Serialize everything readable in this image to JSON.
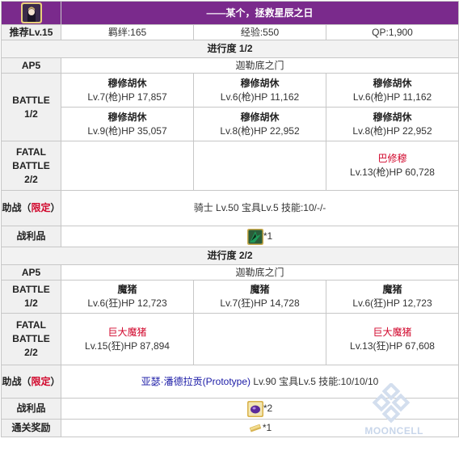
{
  "header": {
    "icon": "servant-portrait-icon",
    "title": "——某个，拯救星辰之日",
    "rec_level_label": "推荐Lv.15",
    "bond": "羁绊:165",
    "exp": "经验:550",
    "qp": "QP:1,900"
  },
  "stages": [
    {
      "progress": "进行度 1/2",
      "ap_label": "AP5",
      "location": "迦勒底之门",
      "battle1_label": [
        "BATTLE",
        "1/2"
      ],
      "battle1_rows": [
        [
          {
            "name": "穆修胡休",
            "stat": "Lv.7(枪)HP 17,857"
          },
          {
            "name": "穆修胡休",
            "stat": "Lv.6(枪)HP 11,162"
          },
          {
            "name": "穆修胡休",
            "stat": "Lv.6(枪)HP 11,162"
          }
        ],
        [
          {
            "name": "穆修胡休",
            "stat": "Lv.9(枪)HP 35,057"
          },
          {
            "name": "穆修胡休",
            "stat": "Lv.8(枪)HP 22,952"
          },
          {
            "name": "穆修胡休",
            "stat": "Lv.8(枪)HP 22,952"
          }
        ]
      ],
      "fatal_label": [
        "FATAL",
        "BATTLE",
        "2/2"
      ],
      "fatal": [
        {
          "name": "",
          "stat": ""
        },
        {
          "name": "",
          "stat": ""
        },
        {
          "name": "巴修穆",
          "stat": "Lv.13(枪)HP 60,728"
        }
      ],
      "support_label_1": "助战（",
      "support_label_red": "限定",
      "support_label_2": "）",
      "support": "骑士 Lv.50 宝具Lv.5 技能:10/-/-",
      "drops_label": "战利品",
      "drop_icon": "lancer-piece-icon",
      "drop_count": "*1"
    },
    {
      "progress": "进行度 2/2",
      "ap_label": "AP5",
      "location": "迦勒底之门",
      "battle1_label": [
        "BATTLE",
        "1/2"
      ],
      "battle1": [
        {
          "name": "魔猪",
          "stat": "Lv.6(狂)HP 12,723"
        },
        {
          "name": "魔猪",
          "stat": "Lv.7(狂)HP 14,728"
        },
        {
          "name": "魔猪",
          "stat": "Lv.6(狂)HP 12,723"
        }
      ],
      "fatal_label": [
        "FATAL",
        "BATTLE",
        "2/2"
      ],
      "fatal": [
        {
          "name": "巨大魔猪",
          "stat": "Lv.15(狂)HP 87,894"
        },
        {
          "name": "",
          "stat": ""
        },
        {
          "name": "巨大魔猪",
          "stat": "Lv.13(狂)HP 67,608"
        }
      ],
      "support_label_1": "助战（",
      "support_label_red": "限定",
      "support_label_2": "）",
      "support_name": "亚瑟·潘德拉贡(Prototype)",
      "support_rest": " Lv.90 宝具Lv.5 技能:10/10/10",
      "drops_label": "战利品",
      "drop_icon": "purple-gem-icon",
      "drop_count": "*2",
      "reward_label": "通关奖励",
      "reward_icon": "golden-ticket-icon",
      "reward_count": "*1"
    }
  ],
  "watermark": "MOONCELL",
  "colors": {
    "title_bg": "#7a2a8c",
    "accent_red": "#d1062b",
    "support_blue": "#1a1aa6"
  }
}
